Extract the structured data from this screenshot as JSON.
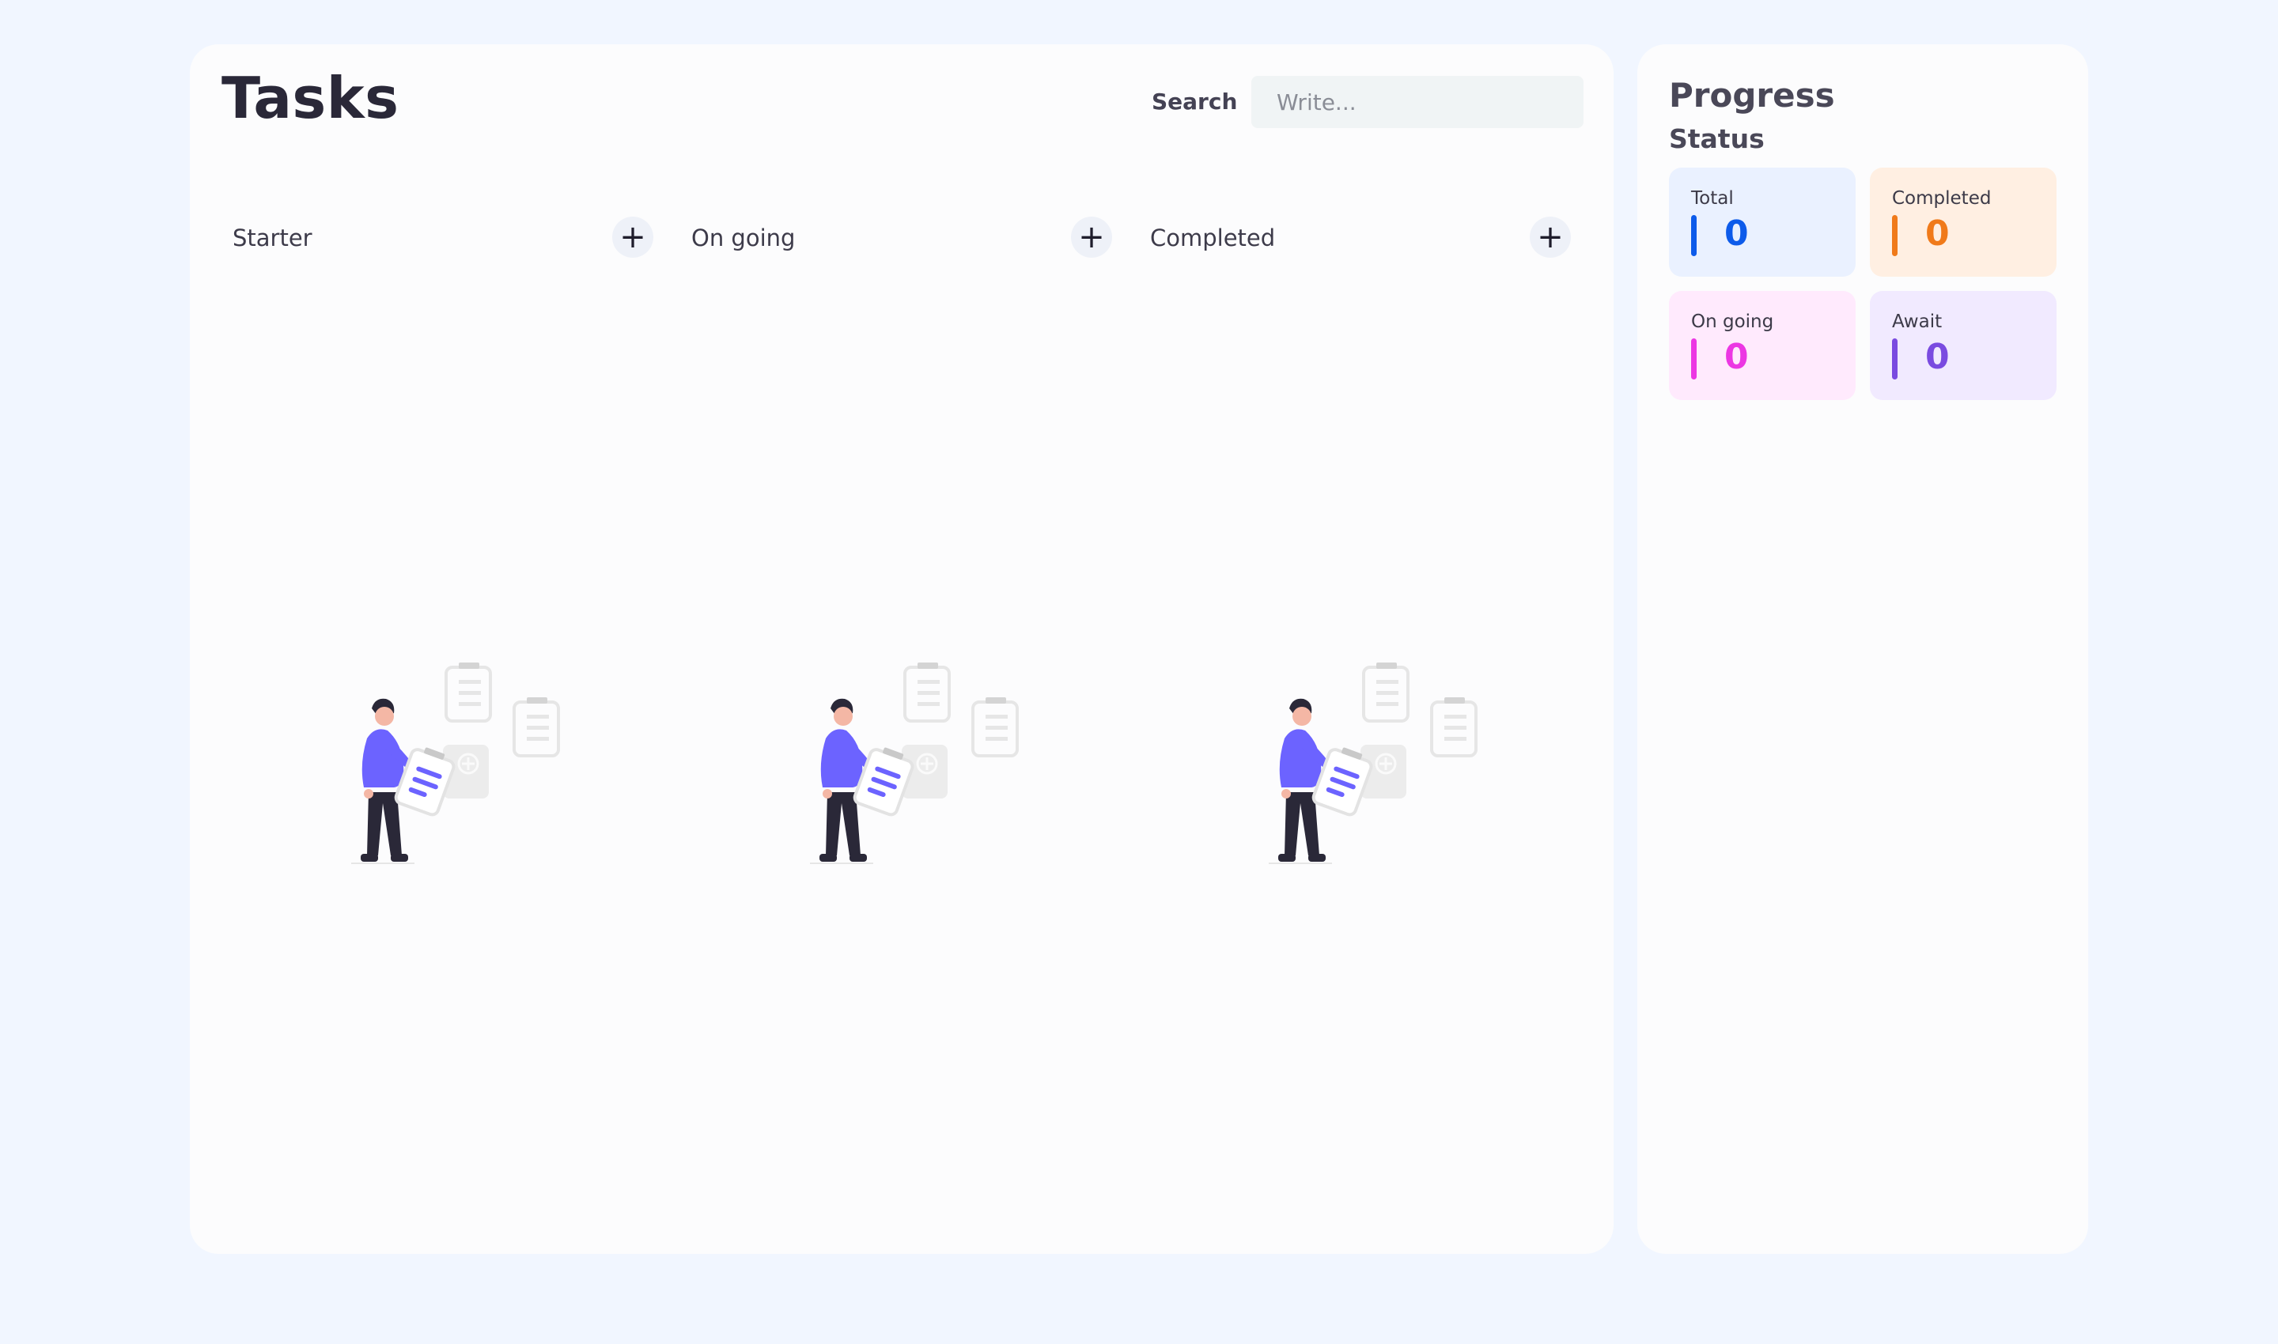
{
  "header": {
    "title": "Tasks",
    "search_label": "Search",
    "search_placeholder": "Write...",
    "search_value": ""
  },
  "columns": [
    {
      "title": "Starter",
      "add_symbol": "+"
    },
    {
      "title": "On going",
      "add_symbol": "+"
    },
    {
      "title": "Completed",
      "add_symbol": "+"
    }
  ],
  "empty_state_icon": "person-holding-clipboard-illustration",
  "progress": {
    "title": "Progress",
    "status_title": "Status",
    "cards": [
      {
        "label": "Total",
        "value": "0",
        "color": "#0d5bea",
        "bg": "#eaf1ff"
      },
      {
        "label": "Completed",
        "value": "0",
        "color": "#f07a1a",
        "bg": "#ffefe2"
      },
      {
        "label": "On going",
        "value": "0",
        "color": "#ec37e3",
        "bg": "#ffeafd"
      },
      {
        "label": "Await",
        "value": "0",
        "color": "#7a4be0",
        "bg": "#f1eaff"
      }
    ]
  },
  "colors": {
    "background": "#f1f6ff",
    "panel": "#fcfcfd",
    "accent_illustration": "#6c63ff"
  }
}
